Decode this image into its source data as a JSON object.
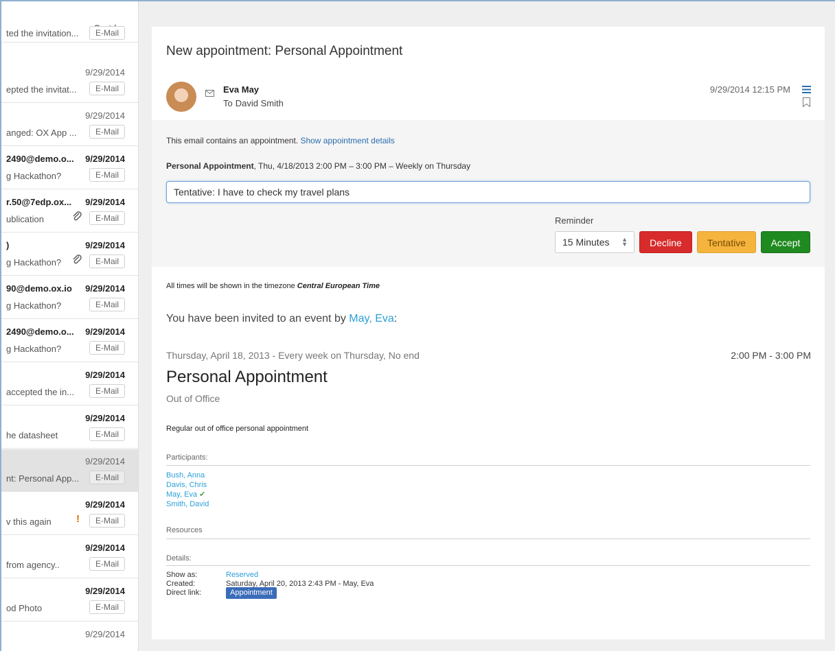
{
  "list": {
    "sort_label": "Sort by",
    "rows": [
      {
        "sender": "",
        "date": "",
        "subject": "ted the invitation...",
        "tag": "E-Mail"
      },
      {
        "sender": "",
        "date": "9/29/2014",
        "subject": "epted the invitat...",
        "tag": "E-Mail"
      },
      {
        "sender": "",
        "date": "9/29/2014",
        "subject": "anged: OX App ...",
        "tag": "E-Mail"
      },
      {
        "sender": "2490@demo.o...",
        "date": "9/29/2014",
        "subject": "g Hackathon?",
        "tag": "E-Mail"
      },
      {
        "sender": "r.50@7edp.ox...",
        "date": "9/29/2014",
        "subject": "ublication",
        "tag": "E-Mail"
      },
      {
        "sender": ")",
        "date": "9/29/2014",
        "subject": "g Hackathon?",
        "tag": "E-Mail"
      },
      {
        "sender": "90@demo.ox.io",
        "date": "9/29/2014",
        "subject": "g Hackathon?",
        "tag": "E-Mail"
      },
      {
        "sender": "2490@demo.o...",
        "date": "9/29/2014",
        "subject": "g Hackathon?",
        "tag": "E-Mail"
      },
      {
        "sender": "",
        "date": "9/29/2014",
        "subject": "accepted the in...",
        "tag": "E-Mail"
      },
      {
        "sender": "",
        "date": "9/29/2014",
        "subject": "he datasheet",
        "tag": "E-Mail"
      },
      {
        "sender": "",
        "date": "9/29/2014",
        "subject": "nt: Personal App...",
        "tag": "E-Mail"
      },
      {
        "sender": "",
        "date": "9/29/2014",
        "subject": "v this again",
        "tag": "E-Mail"
      },
      {
        "sender": "",
        "date": "9/29/2014",
        "subject": " from agency..",
        "tag": "E-Mail"
      },
      {
        "sender": "",
        "date": "9/29/2014",
        "subject": "od Photo",
        "tag": "E-Mail"
      },
      {
        "sender": "",
        "date": "9/29/2014",
        "subject": "",
        "tag": ""
      }
    ],
    "flag_glyph": "!"
  },
  "mail": {
    "title": "New appointment: Personal Appointment",
    "from_name": "Eva May",
    "to_label": "To",
    "to_name": "David Smith",
    "date": "9/29/2014 12:15 PM"
  },
  "appointment": {
    "intro": "This email contains an appointment.",
    "details_link": "Show appointment details",
    "summary_title": "Personal Appointment",
    "summary_rest": ", Thu, 4/18/2013 2:00 PM – 3:00 PM – Weekly on Thursday",
    "comment_value": "Tentative: I have to check my travel plans",
    "reminder_label": "Reminder",
    "reminder_value": "15 Minutes",
    "decline_label": "Decline",
    "tentative_label": "Tentative",
    "accept_label": "Accept"
  },
  "event": {
    "tz_prefix": "All times will be shown in the timezone",
    "tz_name": "Central European Time",
    "invite_prefix": "You have been invited to an event by",
    "invite_by": "May, Eva",
    "invite_suffix": ":",
    "recurrence": "Thursday, April 18, 2013 - Every week on Thursday, No end",
    "time_range": "2:00 PM - 3:00 PM",
    "title": "Personal Appointment",
    "location": "Out of Office",
    "description": "Regular out of office personal appointment",
    "participants_label": "Participants:",
    "participants": [
      "Bush, Anna",
      "Davis, Chris",
      "May, Eva",
      "Smith, David"
    ],
    "accepted_mark": "✔",
    "resources_label": "Resources",
    "details_label": "Details:",
    "show_as_key": "Show as:",
    "show_as_value": "Reserved",
    "created_key": "Created:",
    "created_value": "Saturday, April 20, 2013 2:43 PM - May, Eva",
    "direct_link_key": "Direct link:",
    "direct_link_value": "Appointment"
  },
  "colors": {
    "decline": "#d82b2b",
    "tentative": "#f4b43e",
    "accept": "#1f8a1f",
    "link": "#2b9fd8"
  },
  "icons": [
    "envelope-icon",
    "menu-icon",
    "bookmark-icon",
    "paperclip-icon",
    "flag-icon",
    "select-arrows-icon",
    "checkmark-icon"
  ]
}
